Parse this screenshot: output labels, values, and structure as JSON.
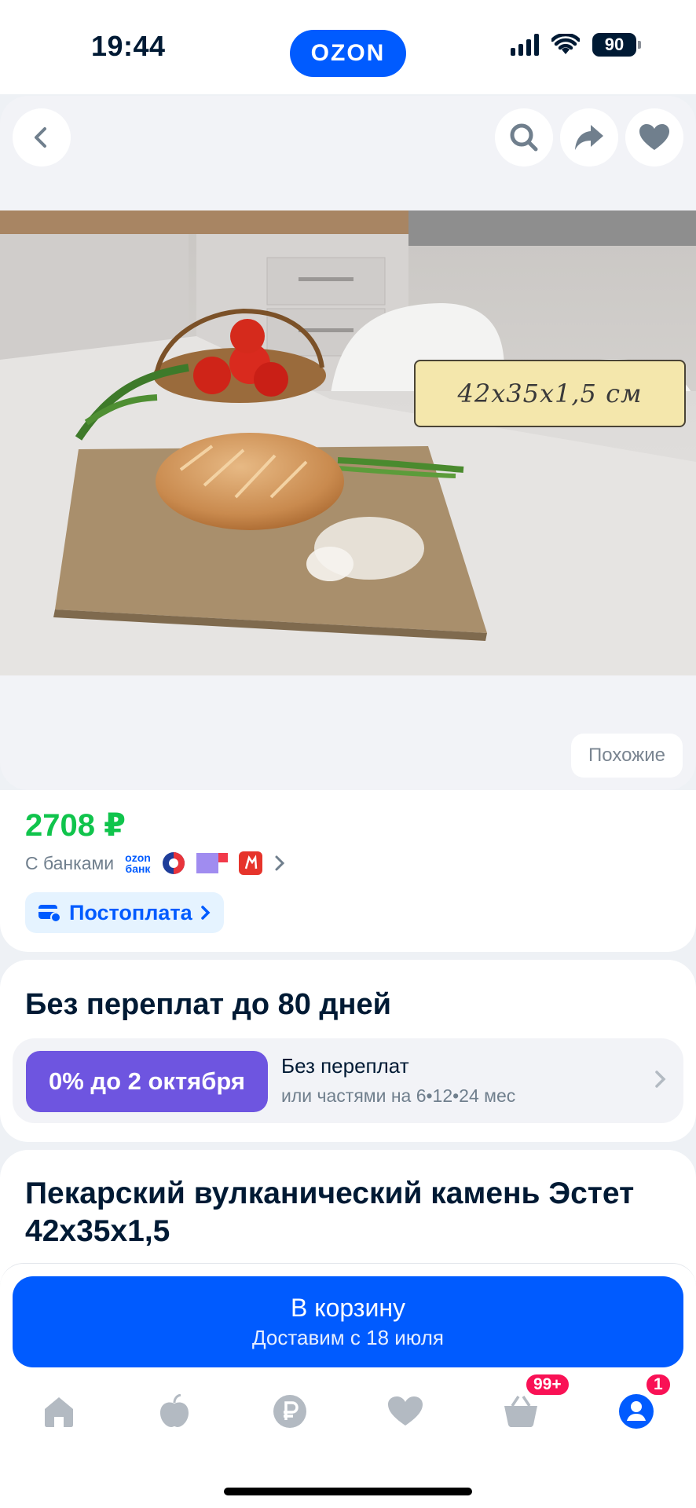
{
  "status_bar": {
    "time": "19:44",
    "brand": "OZON",
    "battery": "90"
  },
  "header": {
    "back_icon": "chevron-left-icon",
    "search_icon": "search-icon",
    "share_icon": "share-arrow-icon",
    "favorite_icon": "heart-icon"
  },
  "gallery": {
    "size_label": "42x35x1,5 см",
    "similar_label": "Похожие"
  },
  "price_block": {
    "price": "2708 ₽",
    "banks_label": "С банками",
    "ozon_bank_line1": "ozon",
    "ozon_bank_line2": "банк",
    "postpay_label": "Постоплата"
  },
  "installment": {
    "title": "Без переплат до 80 дней",
    "badge": "0% до 2 октября",
    "line1": "Без переплат",
    "line2": "или частями на 6•12•24 мес"
  },
  "product": {
    "title": "Пекарский вулканический камень Эстет 42x35x1,5"
  },
  "cart_button": {
    "label": "В корзину",
    "delivery": "Доставим с 18 июля"
  },
  "tabbar": {
    "items": [
      {
        "icon": "home-icon"
      },
      {
        "icon": "fresh-apple-icon"
      },
      {
        "icon": "ruble-icon"
      },
      {
        "icon": "heart-icon"
      },
      {
        "icon": "basket-icon",
        "badge": "99+"
      },
      {
        "icon": "profile-icon",
        "badge": "1"
      }
    ]
  },
  "colors": {
    "accent": "#005bff",
    "price": "#10c44c",
    "installment": "#6e55e0",
    "badge": "#f91155"
  }
}
